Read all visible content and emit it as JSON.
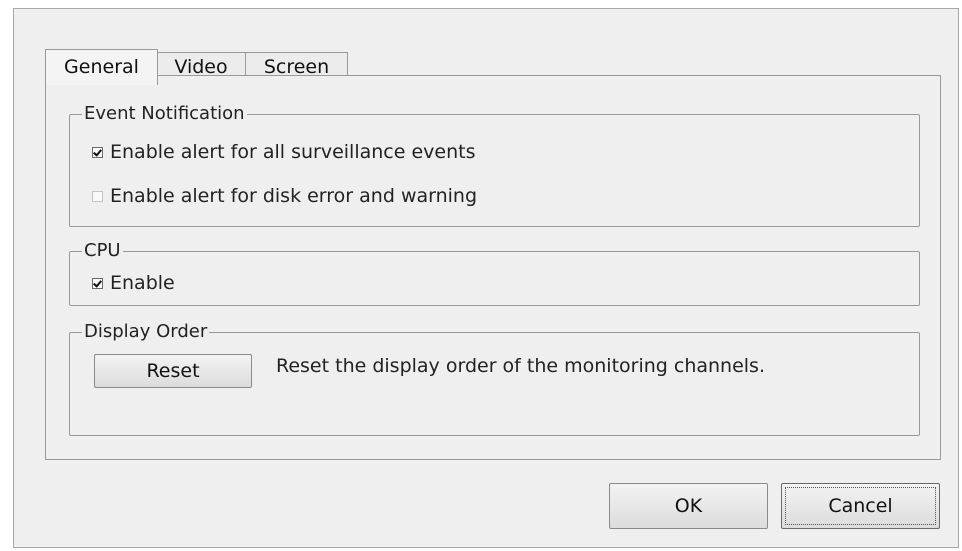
{
  "tabs": [
    {
      "label": "General",
      "active": true
    },
    {
      "label": "Video",
      "active": false
    },
    {
      "label": "Screen",
      "active": false
    }
  ],
  "event_notification": {
    "legend": "Event Notification",
    "options": [
      {
        "label": "Enable alert for all surveillance events",
        "checked": true,
        "enabled": true
      },
      {
        "label": "Enable alert for disk error and warning",
        "checked": false,
        "enabled": false
      }
    ]
  },
  "cpu": {
    "legend": "CPU",
    "enable_label": "Enable",
    "checked": true
  },
  "display_order": {
    "legend": "Display Order",
    "reset_label": "Reset",
    "description": "Reset the display order of the monitoring channels."
  },
  "buttons": {
    "ok_label": "OK",
    "cancel_label": "Cancel"
  }
}
